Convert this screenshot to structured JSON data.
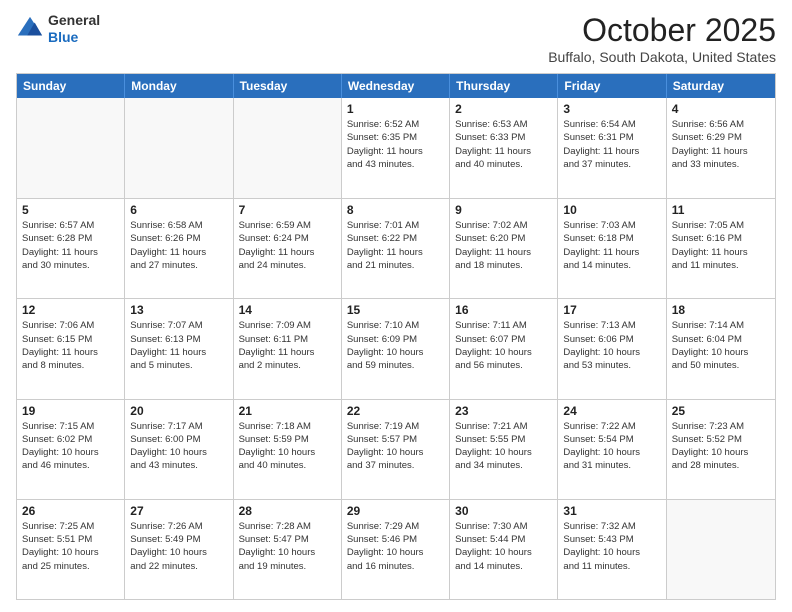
{
  "header": {
    "logo_line1": "General",
    "logo_line2": "Blue",
    "title": "October 2025",
    "subtitle": "Buffalo, South Dakota, United States"
  },
  "days_of_week": [
    "Sunday",
    "Monday",
    "Tuesday",
    "Wednesday",
    "Thursday",
    "Friday",
    "Saturday"
  ],
  "weeks": [
    [
      {
        "day": "",
        "info": "",
        "empty": true
      },
      {
        "day": "",
        "info": "",
        "empty": true
      },
      {
        "day": "",
        "info": "",
        "empty": true
      },
      {
        "day": "1",
        "info": "Sunrise: 6:52 AM\nSunset: 6:35 PM\nDaylight: 11 hours\nand 43 minutes.",
        "empty": false
      },
      {
        "day": "2",
        "info": "Sunrise: 6:53 AM\nSunset: 6:33 PM\nDaylight: 11 hours\nand 40 minutes.",
        "empty": false
      },
      {
        "day": "3",
        "info": "Sunrise: 6:54 AM\nSunset: 6:31 PM\nDaylight: 11 hours\nand 37 minutes.",
        "empty": false
      },
      {
        "day": "4",
        "info": "Sunrise: 6:56 AM\nSunset: 6:29 PM\nDaylight: 11 hours\nand 33 minutes.",
        "empty": false
      }
    ],
    [
      {
        "day": "5",
        "info": "Sunrise: 6:57 AM\nSunset: 6:28 PM\nDaylight: 11 hours\nand 30 minutes.",
        "empty": false
      },
      {
        "day": "6",
        "info": "Sunrise: 6:58 AM\nSunset: 6:26 PM\nDaylight: 11 hours\nand 27 minutes.",
        "empty": false
      },
      {
        "day": "7",
        "info": "Sunrise: 6:59 AM\nSunset: 6:24 PM\nDaylight: 11 hours\nand 24 minutes.",
        "empty": false
      },
      {
        "day": "8",
        "info": "Sunrise: 7:01 AM\nSunset: 6:22 PM\nDaylight: 11 hours\nand 21 minutes.",
        "empty": false
      },
      {
        "day": "9",
        "info": "Sunrise: 7:02 AM\nSunset: 6:20 PM\nDaylight: 11 hours\nand 18 minutes.",
        "empty": false
      },
      {
        "day": "10",
        "info": "Sunrise: 7:03 AM\nSunset: 6:18 PM\nDaylight: 11 hours\nand 14 minutes.",
        "empty": false
      },
      {
        "day": "11",
        "info": "Sunrise: 7:05 AM\nSunset: 6:16 PM\nDaylight: 11 hours\nand 11 minutes.",
        "empty": false
      }
    ],
    [
      {
        "day": "12",
        "info": "Sunrise: 7:06 AM\nSunset: 6:15 PM\nDaylight: 11 hours\nand 8 minutes.",
        "empty": false
      },
      {
        "day": "13",
        "info": "Sunrise: 7:07 AM\nSunset: 6:13 PM\nDaylight: 11 hours\nand 5 minutes.",
        "empty": false
      },
      {
        "day": "14",
        "info": "Sunrise: 7:09 AM\nSunset: 6:11 PM\nDaylight: 11 hours\nand 2 minutes.",
        "empty": false
      },
      {
        "day": "15",
        "info": "Sunrise: 7:10 AM\nSunset: 6:09 PM\nDaylight: 10 hours\nand 59 minutes.",
        "empty": false
      },
      {
        "day": "16",
        "info": "Sunrise: 7:11 AM\nSunset: 6:07 PM\nDaylight: 10 hours\nand 56 minutes.",
        "empty": false
      },
      {
        "day": "17",
        "info": "Sunrise: 7:13 AM\nSunset: 6:06 PM\nDaylight: 10 hours\nand 53 minutes.",
        "empty": false
      },
      {
        "day": "18",
        "info": "Sunrise: 7:14 AM\nSunset: 6:04 PM\nDaylight: 10 hours\nand 50 minutes.",
        "empty": false
      }
    ],
    [
      {
        "day": "19",
        "info": "Sunrise: 7:15 AM\nSunset: 6:02 PM\nDaylight: 10 hours\nand 46 minutes.",
        "empty": false
      },
      {
        "day": "20",
        "info": "Sunrise: 7:17 AM\nSunset: 6:00 PM\nDaylight: 10 hours\nand 43 minutes.",
        "empty": false
      },
      {
        "day": "21",
        "info": "Sunrise: 7:18 AM\nSunset: 5:59 PM\nDaylight: 10 hours\nand 40 minutes.",
        "empty": false
      },
      {
        "day": "22",
        "info": "Sunrise: 7:19 AM\nSunset: 5:57 PM\nDaylight: 10 hours\nand 37 minutes.",
        "empty": false
      },
      {
        "day": "23",
        "info": "Sunrise: 7:21 AM\nSunset: 5:55 PM\nDaylight: 10 hours\nand 34 minutes.",
        "empty": false
      },
      {
        "day": "24",
        "info": "Sunrise: 7:22 AM\nSunset: 5:54 PM\nDaylight: 10 hours\nand 31 minutes.",
        "empty": false
      },
      {
        "day": "25",
        "info": "Sunrise: 7:23 AM\nSunset: 5:52 PM\nDaylight: 10 hours\nand 28 minutes.",
        "empty": false
      }
    ],
    [
      {
        "day": "26",
        "info": "Sunrise: 7:25 AM\nSunset: 5:51 PM\nDaylight: 10 hours\nand 25 minutes.",
        "empty": false
      },
      {
        "day": "27",
        "info": "Sunrise: 7:26 AM\nSunset: 5:49 PM\nDaylight: 10 hours\nand 22 minutes.",
        "empty": false
      },
      {
        "day": "28",
        "info": "Sunrise: 7:28 AM\nSunset: 5:47 PM\nDaylight: 10 hours\nand 19 minutes.",
        "empty": false
      },
      {
        "day": "29",
        "info": "Sunrise: 7:29 AM\nSunset: 5:46 PM\nDaylight: 10 hours\nand 16 minutes.",
        "empty": false
      },
      {
        "day": "30",
        "info": "Sunrise: 7:30 AM\nSunset: 5:44 PM\nDaylight: 10 hours\nand 14 minutes.",
        "empty": false
      },
      {
        "day": "31",
        "info": "Sunrise: 7:32 AM\nSunset: 5:43 PM\nDaylight: 10 hours\nand 11 minutes.",
        "empty": false
      },
      {
        "day": "",
        "info": "",
        "empty": true
      }
    ]
  ]
}
